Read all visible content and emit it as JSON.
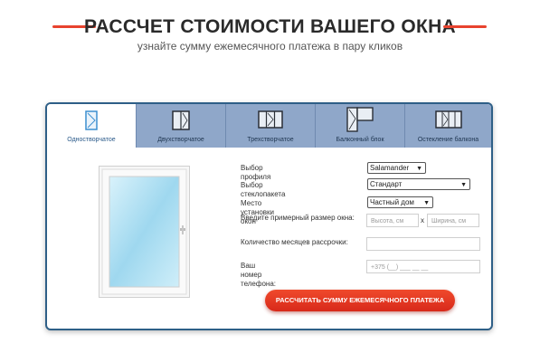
{
  "header": {
    "title": "РАССЧЕТ СТОИМОСТИ ВАШЕГО ОКНА",
    "subtitle": "узнайте сумму ежемесячного платежа в пару кликов",
    "accent_color": "#e8432e"
  },
  "tabs": [
    {
      "label": "Одностворчатое",
      "icon": "single-sash-window-icon",
      "active": true
    },
    {
      "label": "Двухстворчатое",
      "icon": "double-sash-window-icon",
      "active": false
    },
    {
      "label": "Трехстворчатое",
      "icon": "triple-sash-window-icon",
      "active": false
    },
    {
      "label": "Балконный блок",
      "icon": "balcony-block-icon",
      "active": false
    },
    {
      "label": "Остекление балкона",
      "icon": "balcony-glazing-icon",
      "active": false
    }
  ],
  "form": {
    "profile": {
      "label": "Выбор профиля",
      "value": "Salamander"
    },
    "glass": {
      "label": "Выбор стеклопакета",
      "value": "Стандарт"
    },
    "location": {
      "label": "Место установки окон",
      "value": "Частный дом"
    },
    "size": {
      "label": "Введите примерный размер окна:",
      "height_placeholder": "Высота, см",
      "separator": "x",
      "width_placeholder": "Ширина, см"
    },
    "months": {
      "label": "Количество месяцев рассрочки:",
      "value": ""
    },
    "phone": {
      "label": "Ваш номер телефона:",
      "placeholder": "+375 (__) ___ __ __"
    },
    "submit_label": "РАССЧИТАТЬ СУММУ ЕЖЕМЕСЯЧНОГО ПЛАТЕЖА"
  },
  "colors": {
    "panel_border": "#2e5f87",
    "tab_bar": "#8fa7c9",
    "button": "#e23a22"
  }
}
